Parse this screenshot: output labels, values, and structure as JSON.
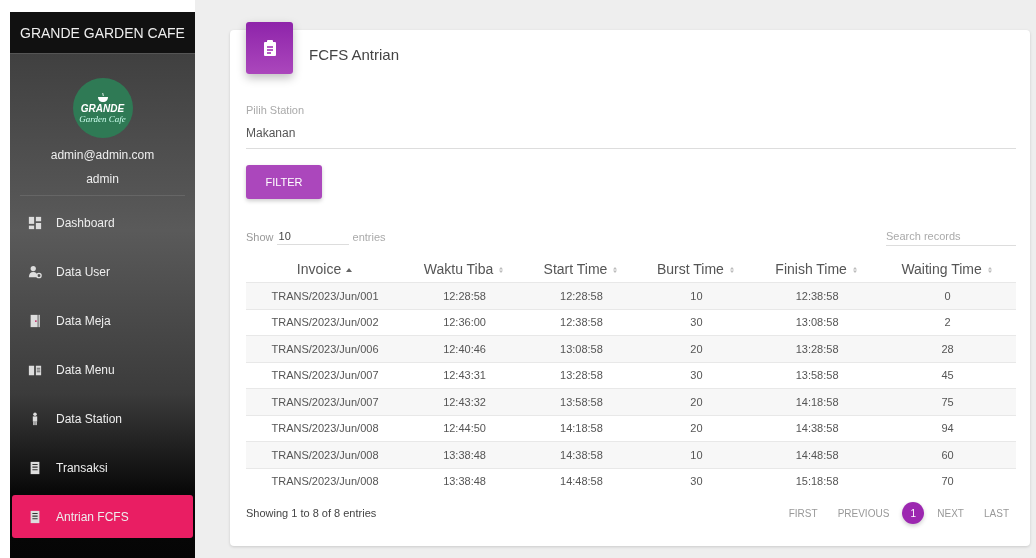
{
  "sidebar": {
    "brand": "GRANDE GARDEN CAFE",
    "logo": {
      "name": "GRANDE",
      "tagline": "Garden Cafe"
    },
    "user": {
      "email": "admin@admin.com",
      "name": "admin"
    },
    "items": [
      {
        "label": "Dashboard",
        "kind": "dashboard",
        "selected": false
      },
      {
        "label": "Data User",
        "kind": "user",
        "selected": false
      },
      {
        "label": "Data Meja",
        "kind": "door",
        "selected": false
      },
      {
        "label": "Data Menu",
        "kind": "book",
        "selected": false
      },
      {
        "label": "Data Station",
        "kind": "person",
        "selected": false
      },
      {
        "label": "Transaksi",
        "kind": "receipt",
        "selected": false
      },
      {
        "label": "Antrian FCFS",
        "kind": "receipt",
        "selected": true
      }
    ]
  },
  "card": {
    "title": "FCFS Antrian",
    "station": {
      "label": "Pilih Station",
      "value": "Makanan"
    },
    "filter_button": "FILTER",
    "length": {
      "prefix": "Show",
      "value": "10",
      "suffix": "entries"
    },
    "search": {
      "placeholder": "Search records"
    },
    "table": {
      "columns": [
        {
          "label": "Invoice",
          "kind": "ascending"
        },
        {
          "label": "Waktu Tiba",
          "kind": "sortable"
        },
        {
          "label": "Start Time",
          "kind": "sortable"
        },
        {
          "label": "Burst Time",
          "kind": "sortable"
        },
        {
          "label": "Finish Time",
          "kind": "sortable"
        },
        {
          "label": "Waiting Time",
          "kind": "sortable"
        }
      ],
      "rows": [
        [
          "TRANS/2023/Jun/001",
          "12:28:58",
          "12:28:58",
          "10",
          "12:38:58",
          "0"
        ],
        [
          "TRANS/2023/Jun/002",
          "12:36:00",
          "12:38:58",
          "30",
          "13:08:58",
          "2"
        ],
        [
          "TRANS/2023/Jun/006",
          "12:40:46",
          "13:08:58",
          "20",
          "13:28:58",
          "28"
        ],
        [
          "TRANS/2023/Jun/007",
          "12:43:31",
          "13:28:58",
          "30",
          "13:58:58",
          "45"
        ],
        [
          "TRANS/2023/Jun/007",
          "12:43:32",
          "13:58:58",
          "20",
          "14:18:58",
          "75"
        ],
        [
          "TRANS/2023/Jun/008",
          "12:44:50",
          "14:18:58",
          "20",
          "14:38:58",
          "94"
        ],
        [
          "TRANS/2023/Jun/008",
          "13:38:48",
          "14:38:58",
          "10",
          "14:48:58",
          "60"
        ],
        [
          "TRANS/2023/Jun/008",
          "13:38:48",
          "14:48:58",
          "30",
          "15:18:58",
          "70"
        ]
      ]
    },
    "info": "Showing 1 to 8 of 8 entries",
    "pagination": [
      {
        "label": "FIRST",
        "kind": "nav",
        "selected": false
      },
      {
        "label": "PREVIOUS",
        "kind": "nav",
        "selected": false
      },
      {
        "label": "1",
        "kind": "page",
        "selected": true
      },
      {
        "label": "NEXT",
        "kind": "nav",
        "selected": false
      },
      {
        "label": "LAST",
        "kind": "nav",
        "selected": false
      }
    ]
  }
}
